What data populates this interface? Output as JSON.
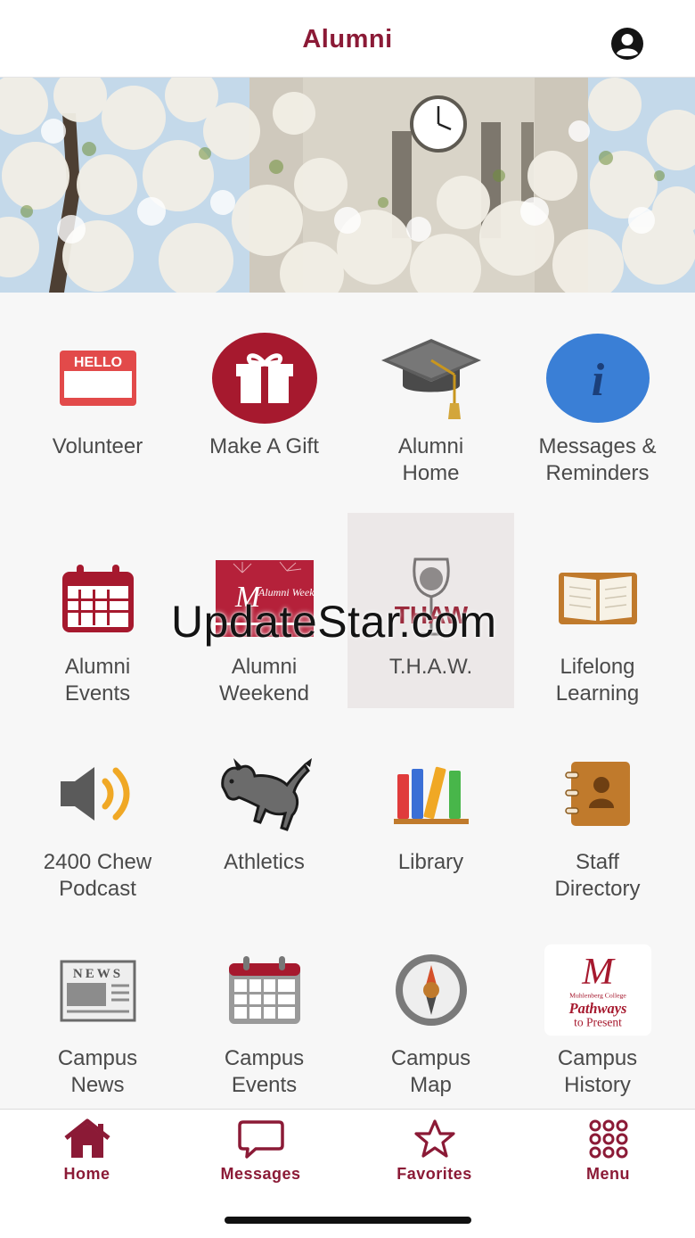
{
  "header": {
    "title": "Alumni",
    "profile_icon": "account-circle-icon"
  },
  "hero": {
    "description_icon": "campus-clock-tower-photo"
  },
  "tiles": [
    {
      "label": "Volunteer",
      "icon": "hello-name-tag-icon"
    },
    {
      "label": "Make A Gift",
      "icon": "gift-icon"
    },
    {
      "label": "Alumni\nHome",
      "icon": "graduation-cap-icon"
    },
    {
      "label": "Messages &\nReminders",
      "icon": "info-icon"
    },
    {
      "label": "Alumni\nEvents",
      "icon": "calendar-icon"
    },
    {
      "label": "Alumni\nWeekend",
      "icon": "alumni-weekend-logo",
      "logo_text": "Alumni Weekend"
    },
    {
      "label": "T.H.A.W.",
      "icon": "thaw-wine-glass-logo",
      "logo_text": "THAW"
    },
    {
      "label": "Lifelong\nLearning",
      "icon": "open-book-icon"
    },
    {
      "label": "2400 Chew\nPodcast",
      "icon": "speaker-icon"
    },
    {
      "label": "Athletics",
      "icon": "mule-mascot-icon"
    },
    {
      "label": "Library",
      "icon": "books-icon"
    },
    {
      "label": "Staff\nDirectory",
      "icon": "address-book-icon"
    },
    {
      "label": "Campus\nNews",
      "icon": "newspaper-icon",
      "icon_text": "NEWS"
    },
    {
      "label": "Campus\nEvents",
      "icon": "calendar-grey-icon"
    },
    {
      "label": "Campus\nMap",
      "icon": "compass-icon"
    },
    {
      "label": "Campus\nHistory",
      "icon": "pathways-logo",
      "logo_line1": "Muhlenberg College",
      "logo_line2": "Pathways",
      "logo_line3": "to Present"
    }
  ],
  "watermark": "UpdateStar.com",
  "tabbar": [
    {
      "label": "Home",
      "icon": "house-icon"
    },
    {
      "label": "Messages",
      "icon": "chat-bubble-icon"
    },
    {
      "label": "Favorites",
      "icon": "star-icon"
    },
    {
      "label": "Menu",
      "icon": "grid-dots-icon"
    }
  ],
  "colors": {
    "brand": "#8b1a36",
    "label_text": "#4a4a4a",
    "info_blue": "#3a7fd6"
  }
}
